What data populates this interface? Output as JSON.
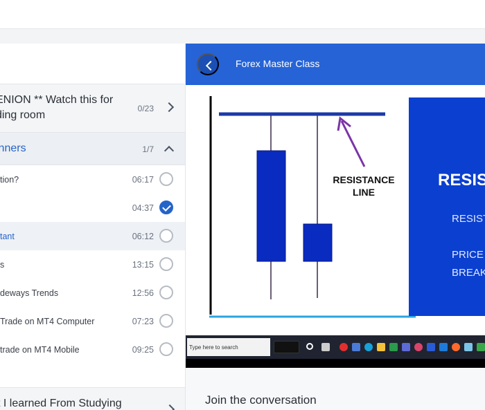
{
  "course": {
    "title": "Forex Master Class"
  },
  "sidebar": {
    "sections": [
      {
        "title_line1": "ENION ** Watch this for",
        "title_line2": "ding room",
        "count": "0/23",
        "expanded": false
      },
      {
        "title_line1": "inners",
        "count": "1/7",
        "expanded": true
      },
      {
        "title_line1": "t I learned From Studying",
        "expanded": false
      }
    ],
    "lessons": [
      {
        "name": "tion?",
        "duration": "06:17",
        "done": false,
        "active": false
      },
      {
        "name": "",
        "duration": "04:37",
        "done": true,
        "active": false
      },
      {
        "name": "tant",
        "duration": "06:12",
        "done": false,
        "active": true
      },
      {
        "name": "s",
        "duration": "13:15",
        "done": false,
        "active": false
      },
      {
        "name": "deways Trends",
        "duration": "12:56",
        "done": false,
        "active": false
      },
      {
        "name": "Trade on MT4 Computer",
        "duration": "07:23",
        "done": false,
        "active": false
      },
      {
        "name": "trade on MT4 Mobile",
        "duration": "09:25",
        "done": false,
        "active": false
      }
    ]
  },
  "video": {
    "slide_label_line1": "RESISTANCE",
    "slide_label_line2": "LINE",
    "panel_title": "RESIS",
    "panel_line1": "RESIST",
    "panel_line2": "PRICE",
    "panel_line3": "BREAK",
    "taskbar_search": "Type here to search"
  },
  "conversation": {
    "heading": "Join the conversation"
  },
  "colors": {
    "accent": "#2563d6",
    "link": "#2563c9",
    "candle": "#0a2bbf",
    "line": "#1b3aa8"
  }
}
